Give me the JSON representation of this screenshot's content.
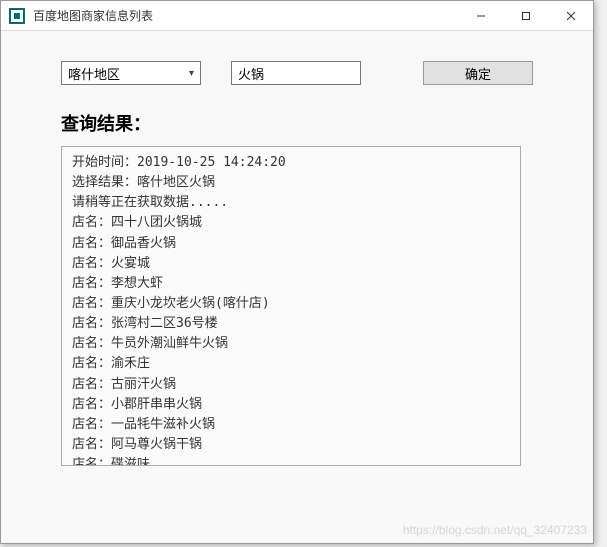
{
  "window": {
    "title": "百度地图商家信息列表"
  },
  "form": {
    "region_selected": "喀什地区",
    "keyword_value": "火锅",
    "ok_label": "确定"
  },
  "result": {
    "header": "查询结果：",
    "start_time_label": "开始时间：",
    "start_time_value": "2019-10-25 14:24:20",
    "select_result_label": "选择结果：",
    "select_result_value": "喀什地区火锅",
    "loading_text": "请稍等正在获取数据.....",
    "shop_label": "店名：",
    "shops": [
      "四十八团火锅城",
      "御品香火锅",
      "火宴城",
      "李想大虾",
      "重庆小龙坎老火锅(喀什店)",
      "张湾村二区36号楼",
      "牛员外潮汕鲜牛火锅",
      "渝禾庄",
      "古丽汗火锅",
      "小郡肝串串火锅",
      "一品牦牛滋补火锅",
      "阿马尊火锅干锅",
      "碟滋味"
    ]
  },
  "watermark": "https://blog.csdn.net/qq_32407233"
}
